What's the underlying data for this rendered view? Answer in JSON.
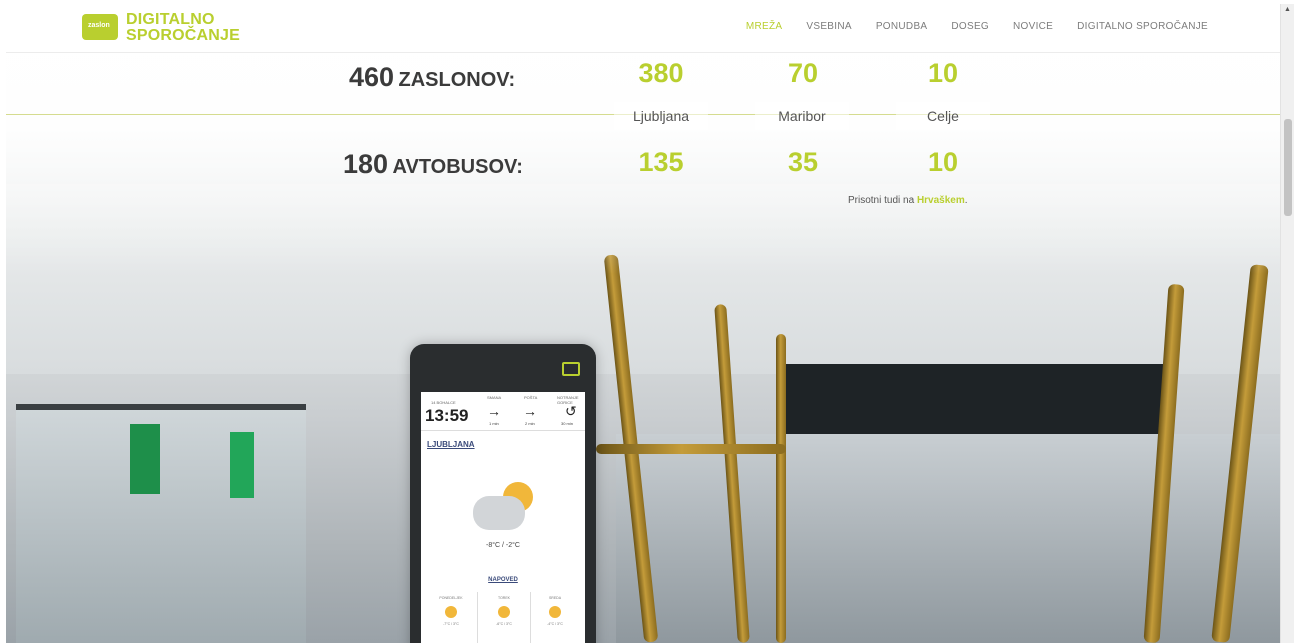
{
  "brand": {
    "badge": "zaslon",
    "line1": "DIGITALNO",
    "line2": "SPOROČANJE"
  },
  "nav": [
    "MREŽA",
    "VSEBINA",
    "PONUDBA",
    "DOSEG",
    "NOVICE",
    "DIGITALNO SPOROČANJE"
  ],
  "stats": {
    "screens": {
      "number": "460",
      "label": "ZASLONOV:",
      "values": [
        "380",
        "70",
        "10"
      ]
    },
    "cities": [
      "Ljubljana",
      "Maribor",
      "Celje"
    ],
    "buses": {
      "number": "180",
      "label": "AVTOBUSOV:",
      "values": [
        "135",
        "35",
        "10"
      ]
    },
    "note_prefix": "Prisotni tudi na ",
    "note_link": "Hrvaškem",
    "note_suffix": "."
  },
  "device": {
    "date_small": "14 BOHALCE",
    "time": "13:59",
    "col1_title": "SMANA",
    "col1_sub": "1 min",
    "col2_title": "POŠTA",
    "col2_sub": "2 min",
    "col3_title": "NOTRANJE GORICE",
    "col3_sub": "30 min",
    "city": "LJUBLJANA",
    "temperature": "-8°C / -2°C",
    "forecast_title": "NAPOVED",
    "forecast": [
      {
        "day": "PONEDELJEK",
        "temp": "-7°C / 3°C"
      },
      {
        "day": "TOREK",
        "temp": "-6°C / 3°C"
      },
      {
        "day": "SREDA",
        "temp": "-4°C / 3°C"
      }
    ]
  },
  "colors": {
    "accent": "#b9cf2f",
    "text": "#3b3b3b"
  }
}
